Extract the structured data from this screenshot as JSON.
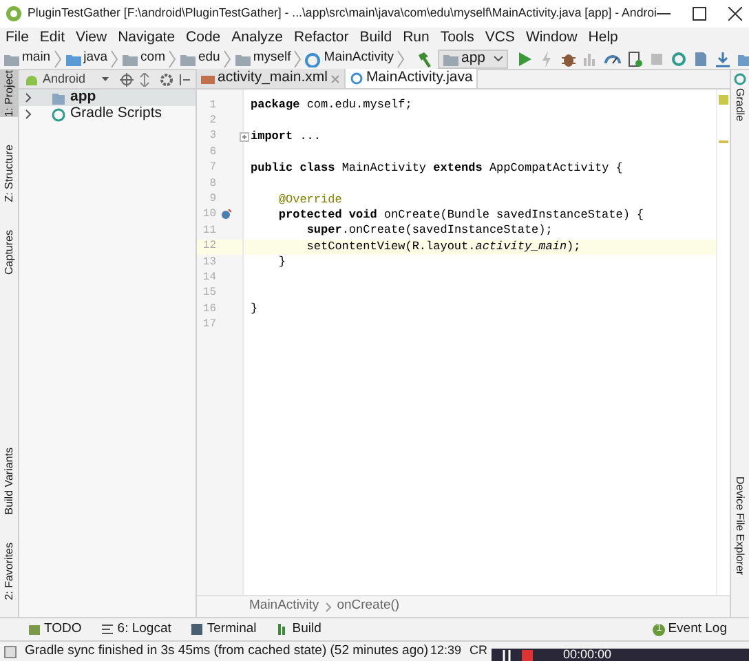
{
  "window": {
    "title": "PluginTestGather [F:\\android\\PluginTestGather] - ...\\app\\src\\main\\java\\com\\edu\\myself\\MainActivity.java [app] - Androi"
  },
  "menu": [
    "File",
    "Edit",
    "View",
    "Navigate",
    "Code",
    "Analyze",
    "Refactor",
    "Build",
    "Run",
    "Tools",
    "VCS",
    "Window",
    "Help"
  ],
  "navigation_bar": [
    {
      "label": "main",
      "kind": "folder"
    },
    {
      "label": "java",
      "kind": "source"
    },
    {
      "label": "com",
      "kind": "folder"
    },
    {
      "label": "edu",
      "kind": "folder"
    },
    {
      "label": "myself",
      "kind": "folder"
    },
    {
      "label": "MainActivity",
      "kind": "class"
    }
  ],
  "run_configuration": "app",
  "left_tool_tabs": [
    {
      "label": "1: Project",
      "selected": true
    },
    {
      "label": "Z: Structure",
      "selected": false
    },
    {
      "label": "Captures",
      "selected": false
    },
    {
      "label": "Build Variants",
      "selected": false
    },
    {
      "label": "2: Favorites",
      "selected": false
    }
  ],
  "project_panel": {
    "view": "Android",
    "tree": [
      {
        "label": "app",
        "selected": true,
        "kind": "module"
      },
      {
        "label": "Gradle Scripts",
        "selected": false,
        "kind": "gradle"
      }
    ]
  },
  "editor_tabs": [
    {
      "label": "activity_main.xml",
      "selected": false
    },
    {
      "label": "MainActivity.java",
      "selected": true
    }
  ],
  "code_lines": [
    {
      "number": "1",
      "text": "**package** com.edu.myself;",
      "current": false,
      "kind": "plain"
    },
    {
      "number": "2",
      "current": false,
      "kind": "plain"
    },
    {
      "number": "3",
      "text": "**import** ...",
      "current": false,
      "kind": "fold"
    },
    {
      "number": "6",
      "current": false,
      "kind": "plain"
    },
    {
      "number": "7",
      "text": "**public class** MainActivity **extends** AppCompatActivity {",
      "current": false,
      "kind": "plain"
    },
    {
      "number": "8",
      "current": false,
      "kind": "plain"
    },
    {
      "number": "9",
      "text": "    @Override",
      "current": false,
      "kind": "annotation"
    },
    {
      "number": "10",
      "text": "    **protected void** onCreate(Bundle savedInstanceState) {",
      "current": false,
      "kind": "override"
    },
    {
      "number": "11",
      "text": "        **super**.onCreate(savedInstanceState);",
      "current": false,
      "kind": "plain"
    },
    {
      "number": "12",
      "text": "        setContentView(R.layout.*activity_main*);",
      "current": true,
      "kind": "plain"
    },
    {
      "number": "13",
      "text": "    }",
      "current": false,
      "kind": "plain"
    },
    {
      "number": "14",
      "current": false,
      "kind": "plain"
    },
    {
      "number": "15",
      "current": false,
      "kind": "plain"
    },
    {
      "number": "16",
      "text": "}",
      "current": false,
      "kind": "plain"
    },
    {
      "number": "17",
      "current": false,
      "kind": "plain"
    }
  ],
  "editor_breadcrumb": [
    "MainActivity",
    "onCreate()"
  ],
  "right_tool_tabs": [
    "Gradle",
    "Device File Explorer"
  ],
  "bottom_tool_tabs": [
    {
      "label": "TODO"
    },
    {
      "label": "6: Logcat"
    },
    {
      "label": "Terminal"
    },
    {
      "label": "Build"
    }
  ],
  "event_log": {
    "label": "Event Log",
    "count": "1"
  },
  "status_bar": {
    "message": "Gradle sync finished in 3s 45ms (from cached state) (52 minutes ago)",
    "position": "12:39",
    "line_separator": "CR"
  },
  "recorder": {
    "time": "00:00:00"
  }
}
